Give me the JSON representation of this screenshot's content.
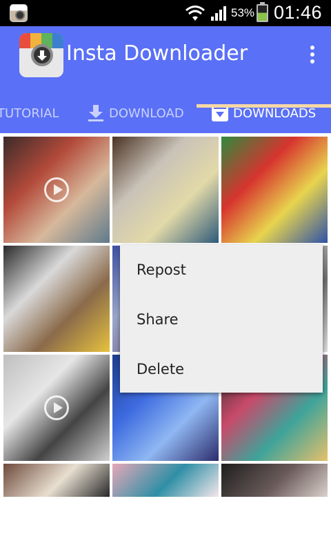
{
  "status_bar": {
    "battery_percent": "53%",
    "time": "01:46",
    "icons": [
      "app-notification-icon",
      "wifi-icon",
      "signal-icon",
      "battery-icon"
    ]
  },
  "app_bar": {
    "title": "Insta Downloader",
    "icons": [
      "app-logo-icon",
      "overflow-menu-icon"
    ],
    "colors": {
      "background": "#5a70f6",
      "tab_indicator": "#f7d8a6"
    }
  },
  "tabs": [
    {
      "label": "TUTORIAL",
      "icon": "",
      "selected": false
    },
    {
      "label": "DOWNLOAD",
      "icon": "download-arrow-icon",
      "selected": false
    },
    {
      "label": "DOWNLOADS",
      "icon": "downloads-box-icon",
      "selected": true
    }
  ],
  "gallery": {
    "items": [
      {
        "type": "video",
        "colors": [
          "#3b2b2a",
          "#b34a3a",
          "#d7b89b",
          "#5e7a8c"
        ]
      },
      {
        "type": "photo",
        "colors": [
          "#4a3324",
          "#c9c2b8",
          "#e2d9a8",
          "#2e5a7a"
        ]
      },
      {
        "type": "photo",
        "colors": [
          "#2f8a3e",
          "#d6342e",
          "#e8d44e",
          "#2e52a8"
        ]
      },
      {
        "type": "photo",
        "colors": [
          "#2a2a2a",
          "#d9d9d9",
          "#8a6a4a",
          "#e6c23e"
        ]
      },
      {
        "type": "photo",
        "colors": [
          "#3b4fa3",
          "#9aa6c9",
          "#7b6f9a",
          "#d6dbea"
        ]
      },
      {
        "type": "photo",
        "colors": [
          "#9a9a9a",
          "#c9c9c9",
          "#6e6e6e",
          "#dcdcdc"
        ]
      },
      {
        "type": "video",
        "colors": [
          "#bfbfbf",
          "#e6e6e6",
          "#444444",
          "#d0d0d0"
        ]
      },
      {
        "type": "photo",
        "colors": [
          "#1c3b8c",
          "#3e6be0",
          "#8fb7f2",
          "#2c2c6b"
        ]
      },
      {
        "type": "photo",
        "colors": [
          "#2a2a2a",
          "#c94a6a",
          "#3ea39a",
          "#e6c06a"
        ]
      },
      {
        "type": "photo",
        "colors": [
          "#6e4a3a",
          "#e8dfd1",
          "#2c2c2c",
          "#c7b39a"
        ]
      },
      {
        "type": "photo",
        "colors": [
          "#e6a8b8",
          "#2f8fa6",
          "#f1e6ea",
          "#3a2a2a"
        ]
      },
      {
        "type": "photo",
        "colors": [
          "#1e1e1e",
          "#6a5a5a",
          "#d9cfc9",
          "#3a3a3a"
        ]
      }
    ]
  },
  "context_menu": {
    "items": [
      "Repost",
      "Share",
      "Delete"
    ]
  }
}
